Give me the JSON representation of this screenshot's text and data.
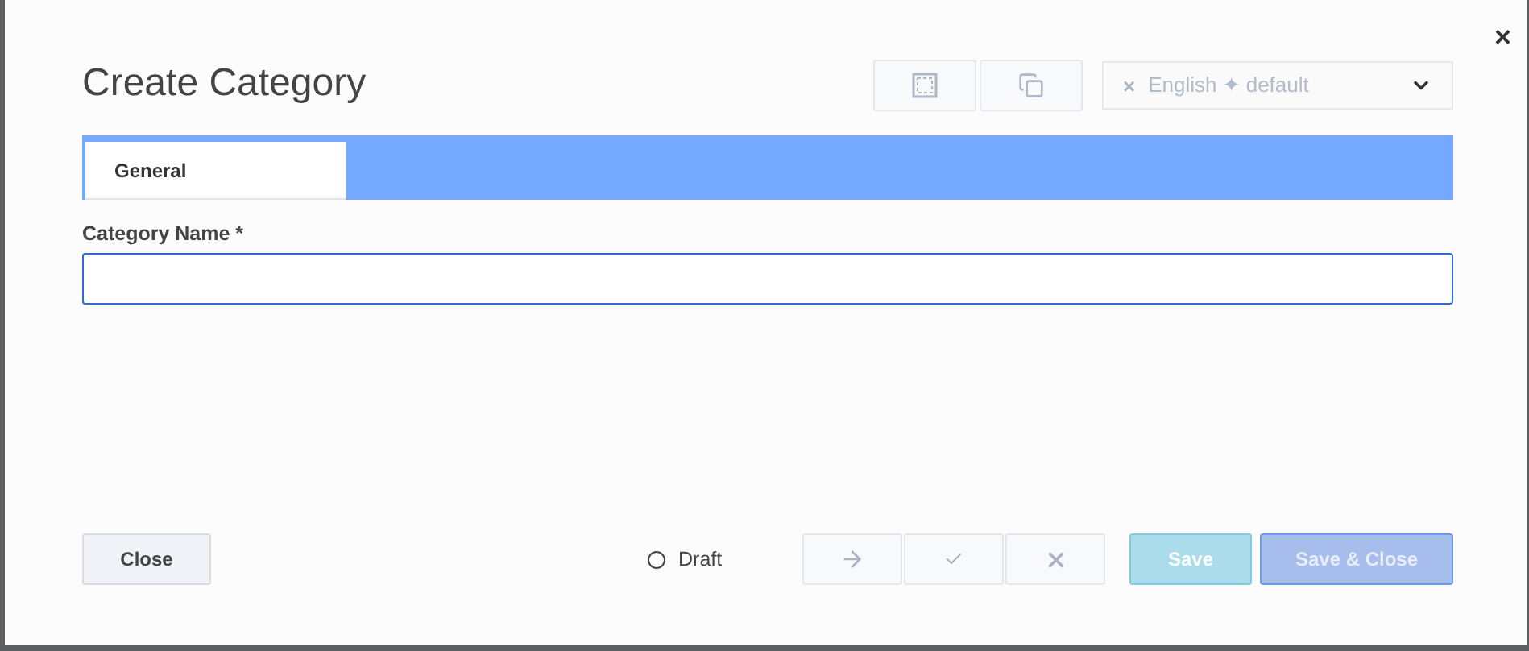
{
  "dialog": {
    "title": "Create Category",
    "close_icon": "×"
  },
  "view_buttons": [
    {
      "kind": "frame"
    },
    {
      "kind": "copy"
    }
  ],
  "language": {
    "clear": "×",
    "value": "English ✦ default"
  },
  "tabs": [
    {
      "label": "General",
      "selected": true
    }
  ],
  "form": {
    "label": "Category Name *"
  },
  "footer": {
    "close": "Close",
    "status": {
      "label": "Draft",
      "checked": false
    },
    "workflow": [
      {
        "kind": "forward",
        "disabled": true
      },
      {
        "kind": "approve",
        "disabled": true
      },
      {
        "kind": "reject",
        "disabled": true
      }
    ],
    "save": {
      "label": "Save",
      "disabled": true
    },
    "save_close": {
      "label": "Save & Close",
      "disabled": true
    }
  }
}
